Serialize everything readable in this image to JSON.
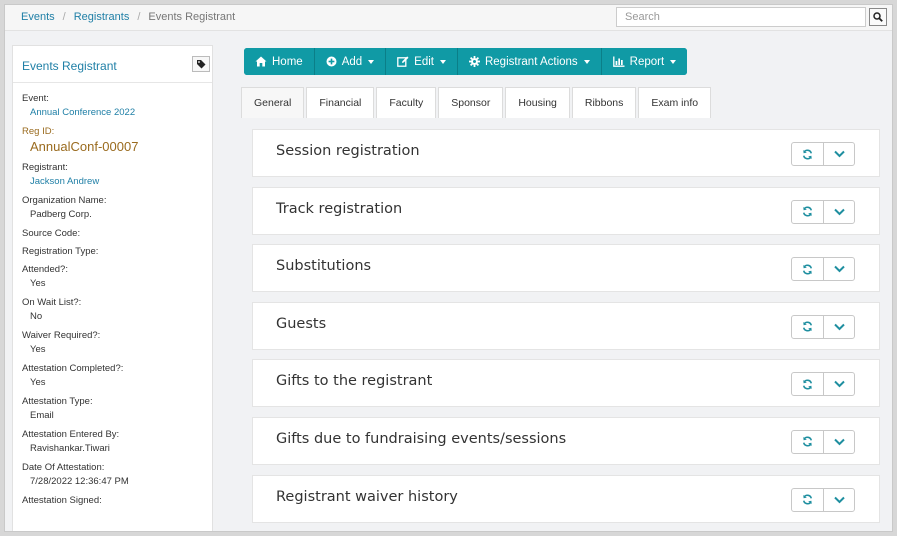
{
  "breadcrumb": {
    "items": [
      "Events",
      "Registrants"
    ],
    "current": "Events Registrant"
  },
  "search": {
    "placeholder": "Search",
    "button_icon": "search-icon"
  },
  "left_panel": {
    "title": "Events Registrant",
    "tag_icon": "tag-icon",
    "fields": [
      {
        "label": "Event:",
        "value": "Annual Conference 2022",
        "style": "link"
      },
      {
        "label": "Reg ID:",
        "value": "AnnualConf-00007",
        "style": "big"
      },
      {
        "label": "Registrant:",
        "value": "Jackson Andrew",
        "style": "link"
      },
      {
        "label": "Organization Name:",
        "value": "Padberg Corp.",
        "style": "plain"
      },
      {
        "label": "Source Code:",
        "value": "",
        "style": "plain"
      },
      {
        "label": "Registration Type:",
        "value": "",
        "style": "plain"
      },
      {
        "label": "Attended?:",
        "value": "Yes",
        "style": "plain"
      },
      {
        "label": "On Wait List?:",
        "value": "No",
        "style": "plain"
      },
      {
        "label": "Waiver Required?:",
        "value": "Yes",
        "style": "plain"
      },
      {
        "label": "Attestation Completed?:",
        "value": "Yes",
        "style": "plain"
      },
      {
        "label": "Attestation Type:",
        "value": "Email",
        "style": "plain"
      },
      {
        "label": "Attestation Entered By:",
        "value": "Ravishankar.Tiwari",
        "style": "plain"
      },
      {
        "label": "Date Of Attestation:",
        "value": "7/28/2022 12:36:47 PM",
        "style": "plain"
      },
      {
        "label": "Attestation Signed:",
        "value": "",
        "style": "plain"
      }
    ]
  },
  "toolbar": {
    "buttons": [
      {
        "label": "Home",
        "icon": "home-icon",
        "dropdown": false
      },
      {
        "label": "Add",
        "icon": "plus-circle-icon",
        "dropdown": true
      },
      {
        "label": "Edit",
        "icon": "edit-icon",
        "dropdown": true
      },
      {
        "label": "Registrant Actions",
        "icon": "gear-icon",
        "dropdown": true
      },
      {
        "label": "Report",
        "icon": "bar-chart-icon",
        "dropdown": true
      }
    ],
    "color": "#109aa5"
  },
  "tabs": [
    {
      "label": "General",
      "active": true
    },
    {
      "label": "Financial",
      "active": false
    },
    {
      "label": "Faculty",
      "active": false
    },
    {
      "label": "Sponsor",
      "active": false
    },
    {
      "label": "Housing",
      "active": false
    },
    {
      "label": "Ribbons",
      "active": false
    },
    {
      "label": "Exam info",
      "active": false
    }
  ],
  "panels": [
    {
      "title": "Session registration"
    },
    {
      "title": "Track registration"
    },
    {
      "title": "Substitutions"
    },
    {
      "title": "Guests"
    },
    {
      "title": "Gifts to the registrant"
    },
    {
      "title": "Gifts due to fundraising events/sessions"
    },
    {
      "title": "Registrant waiver history"
    }
  ],
  "colors": {
    "accent": "#109aa5",
    "link": "#1f7fa6",
    "reg_id": "#9a6b1f"
  }
}
